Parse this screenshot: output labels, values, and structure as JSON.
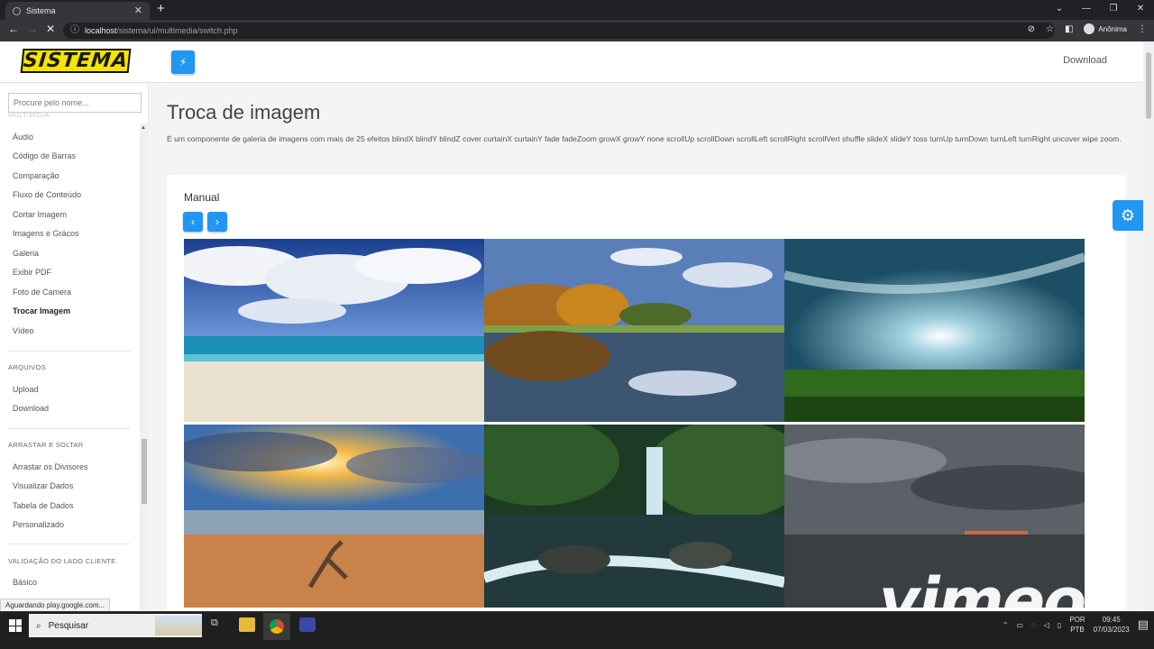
{
  "browser": {
    "tab_title": "Sistema",
    "tab_close": "✕",
    "new_tab": "+",
    "url_host": "localhost",
    "url_path": "/sistema/ui/multimedia/switch.php",
    "profile_label": "Anônima",
    "window_controls": [
      "⌄",
      "—",
      "❐",
      "✕"
    ]
  },
  "header": {
    "logo_text": "SISTEMA",
    "bolt_icon": "⚡",
    "download_link": "Download"
  },
  "sidebar": {
    "search_placeholder": "Procure pelo nome...",
    "sections": [
      {
        "heading": "MULTIMÍDIA",
        "items": [
          "Áudio",
          "Código de Barras",
          "Comparação",
          "Fluxo de Conteúdo",
          "Cortar Imagem",
          "Imagens e Grácos",
          "Galeria",
          "Exibir PDF",
          "Foto de Camera",
          "Trocar Imagem",
          "Vídeo"
        ]
      },
      {
        "heading": "ARQUIVOS",
        "items": [
          "Upload",
          "Download"
        ]
      },
      {
        "heading": "ARRASTAR E SOLTAR",
        "items": [
          "Arrastar os Divisores",
          "Visualizar Dados",
          "Tabela de Dados",
          "Personalizado"
        ]
      },
      {
        "heading": "VALIDAÇÃO DO LADO CLIENTE",
        "items": [
          "Básico"
        ]
      }
    ],
    "active_item": "Trocar Imagem"
  },
  "main": {
    "title": "Troca de imagem",
    "description": "É um componente de galeria de imagens com mais de 25 efeitos blindX blindY blindZ cover curtainX curtainY fade fadeZoom growX growY none scrollUp scrollDown scrollLeft scrollRight scrollVert shuffle slideX slideY toss turnUp turnDown turnLeft turnRight uncover wipe zoom.",
    "card_title": "Manual",
    "prev_icon": "‹",
    "next_icon": "›",
    "images": [
      "beach-clouds",
      "autumn-lake-reflection",
      "sunlit-grass-field",
      "sunset-beach-driftwood",
      "forest-waterfall",
      "stormy-sea-sunset"
    ]
  },
  "settings_icon": "⚙",
  "status_popup": "Aguardando play.google.com...",
  "watermark": "vimeo",
  "taskbar": {
    "search_label": "Pesquisar",
    "language": "POR",
    "layout": "PTB",
    "time": "09:45",
    "date": "07/03/2023"
  }
}
